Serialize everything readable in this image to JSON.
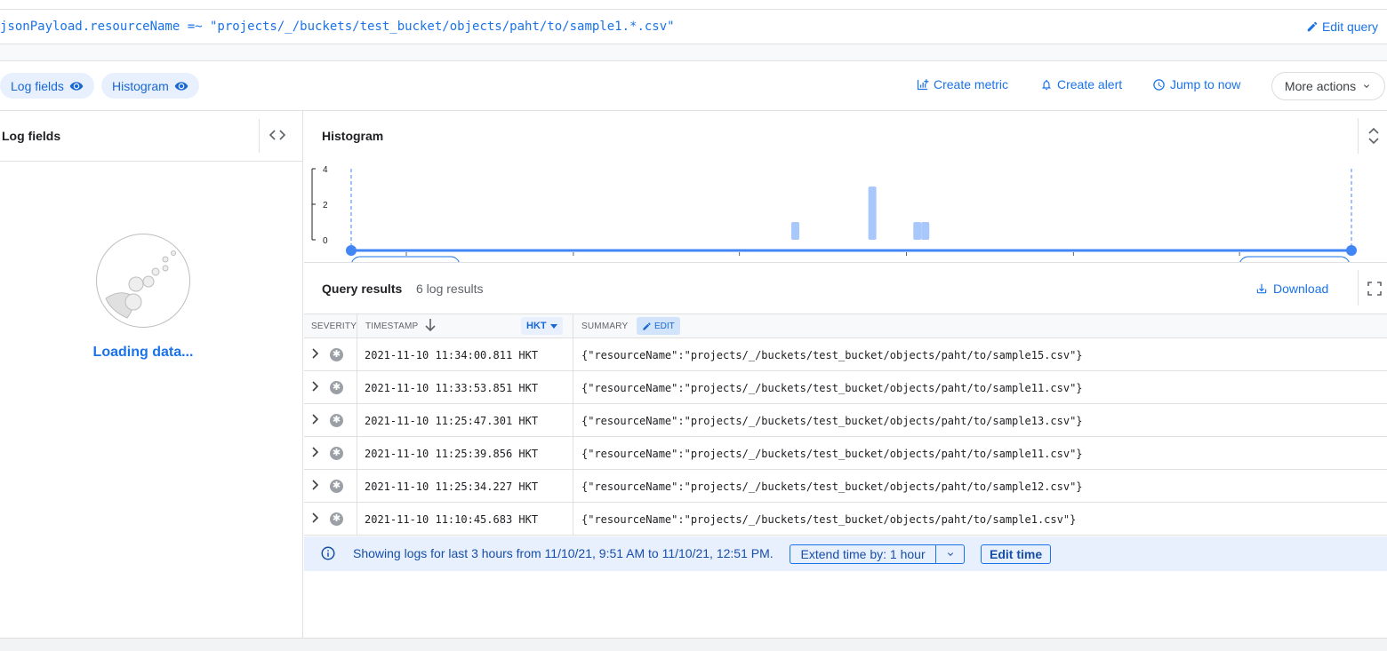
{
  "query": {
    "text": "jsonPayload.resourceName =~ \"projects/_/buckets/test_bucket/objects/paht/to/sample1.*.csv\"",
    "edit_label": "Edit query"
  },
  "toolbar": {
    "chips": [
      {
        "label": "Log fields",
        "icon": "eye-icon"
      },
      {
        "label": "Histogram",
        "icon": "eye-icon"
      }
    ],
    "create_metric": "Create metric",
    "create_alert": "Create alert",
    "jump_to_now": "Jump to now",
    "more_actions": "More actions"
  },
  "log_fields_panel": {
    "title": "Log fields",
    "loading": "Loading data..."
  },
  "histogram": {
    "title": "Histogram",
    "chart_data": {
      "type": "bar",
      "y_ticks": [
        "4",
        "2",
        "0"
      ],
      "ylim": [
        0,
        4
      ],
      "bars": [
        {
          "x": 0.444,
          "value": 1
        },
        {
          "x": 0.521,
          "value": 3
        },
        {
          "x": 0.566,
          "value": 1
        },
        {
          "x": 0.574,
          "value": 1
        }
      ],
      "bar_color": "#a8c7fa",
      "accent_color": "#4285f4"
    }
  },
  "results": {
    "title": "Query results",
    "count": "6 log results",
    "download": "Download",
    "columns": {
      "severity": "SEVERITY",
      "timestamp": "TIMESTAMP",
      "timezone": "HKT",
      "summary": "SUMMARY",
      "edit": "EDIT"
    },
    "rows": [
      {
        "timestamp": "2021-11-10 11:34:00.811 HKT",
        "summary": "{\"resourceName\":\"projects/_/buckets/test_bucket/objects/paht/to/sample15.csv\"}"
      },
      {
        "timestamp": "2021-11-10 11:33:53.851 HKT",
        "summary": "{\"resourceName\":\"projects/_/buckets/test_bucket/objects/paht/to/sample11.csv\"}"
      },
      {
        "timestamp": "2021-11-10 11:25:47.301 HKT",
        "summary": "{\"resourceName\":\"projects/_/buckets/test_bucket/objects/paht/to/sample13.csv\"}"
      },
      {
        "timestamp": "2021-11-10 11:25:39.856 HKT",
        "summary": "{\"resourceName\":\"projects/_/buckets/test_bucket/objects/paht/to/sample11.csv\"}"
      },
      {
        "timestamp": "2021-11-10 11:25:34.227 HKT",
        "summary": "{\"resourceName\":\"projects/_/buckets/test_bucket/objects/paht/to/sample12.csv\"}"
      },
      {
        "timestamp": "2021-11-10 11:10:45.683 HKT",
        "summary": "{\"resourceName\":\"projects/_/buckets/test_bucket/objects/paht/to/sample1.csv\"}"
      }
    ],
    "info": "Showing logs for last 3 hours from 11/10/21, 9:51 AM to 11/10/21, 12:51 PM.",
    "extend": "Extend time by: 1 hour",
    "edit_time": "Edit time"
  }
}
